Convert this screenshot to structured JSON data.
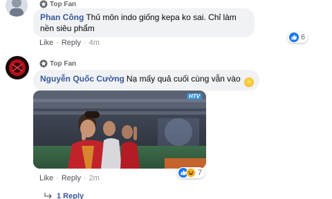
{
  "comments": [
    {
      "badge": "Top Fan",
      "author": "Phan Công",
      "text": "Thủ môn indo giống kepa ko sai. Chỉ làm nền siêu phẩm",
      "actions": {
        "like": "Like",
        "reply": "Reply",
        "dot": "·",
        "time": "4m"
      },
      "reaction_count": "6"
    },
    {
      "badge": "Top Fan",
      "author": "Nguyễn Quốc Cường",
      "text": "Nạ mấy quả cuối cùng vẫn vào",
      "emoji": "😊",
      "actions": {
        "like": "Like",
        "reply": "Reply",
        "dot": "·",
        "time": "2m"
      },
      "reaction_count": "7"
    }
  ],
  "video": {
    "channel_logo": "HTV"
  },
  "replies_link": "1 Reply",
  "colors": {
    "author": "#385898",
    "bubble": "#f0f2f5",
    "like_blue": "#1877f2",
    "haha_yellow": "#f7b125"
  }
}
